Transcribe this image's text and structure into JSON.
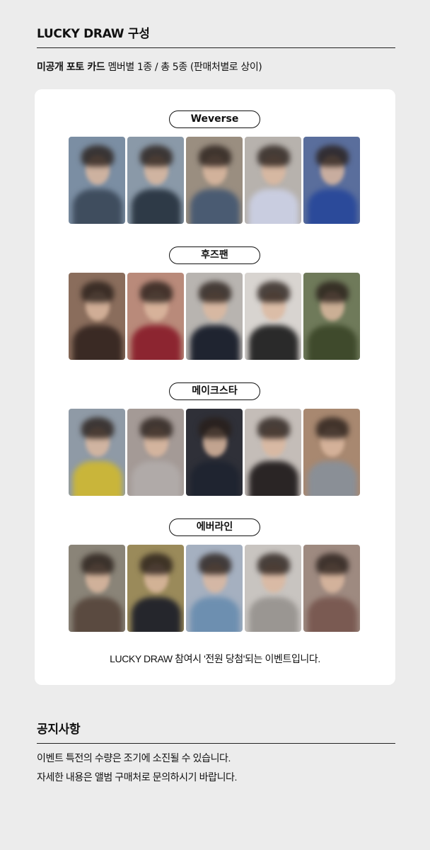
{
  "lucky_draw": {
    "title": "LUCKY DRAW 구성",
    "subtitle_bold": "미공개 포토 카드",
    "subtitle_rest": " 멤버별 1종 / 총 5종 (판매처별로 상이)"
  },
  "stores": [
    {
      "name": "Weverse",
      "photos": [
        {
          "bg": "#7b8ea3",
          "body": "#3f4d5e"
        },
        {
          "bg": "#8a99a8",
          "body": "#2e3a47"
        },
        {
          "bg": "#9a8e80",
          "body": "#4a5b72"
        },
        {
          "bg": "#b7b2ad",
          "body": "#c9cde0"
        },
        {
          "bg": "#5a6e9c",
          "body": "#2b4a9a"
        }
      ]
    },
    {
      "name": "후즈팬",
      "photos": [
        {
          "bg": "#8a6d5c",
          "body": "#3a2a24"
        },
        {
          "bg": "#b98a7a",
          "body": "#8c2530"
        },
        {
          "bg": "#b8b4b0",
          "body": "#1f2430"
        },
        {
          "bg": "#d8d4d0",
          "body": "#2a2a2a"
        },
        {
          "bg": "#6f7a5a",
          "body": "#3f4a2c"
        }
      ]
    },
    {
      "name": "메이크스타",
      "photos": [
        {
          "bg": "#8f9aa6",
          "body": "#c9b53a"
        },
        {
          "bg": "#a49a96",
          "body": "#b0aaa8"
        },
        {
          "bg": "#2f3038",
          "body": "#1f2430"
        },
        {
          "bg": "#c4bdb8",
          "body": "#2a2525"
        },
        {
          "bg": "#a88870",
          "body": "#8a8f96"
        }
      ]
    },
    {
      "name": "에버라인",
      "photos": [
        {
          "bg": "#8a8478",
          "body": "#5a4a40"
        },
        {
          "bg": "#9a8a5a",
          "body": "#25262c"
        },
        {
          "bg": "#a5b0c0",
          "body": "#6d8fb0"
        },
        {
          "bg": "#c8c4c0",
          "body": "#9a9692"
        },
        {
          "bg": "#9e8a80",
          "body": "#7a5a52"
        }
      ]
    }
  ],
  "footnote": "LUCKY DRAW 참여시 '전원 당첨'되는 이벤트입니다.",
  "notice": {
    "title": "공지사항",
    "line1": "이벤트 특전의 수량은 조기에 소진될 수 있습니다.",
    "line2": "자세한 내용은 앨범 구매처로 문의하시기 바랍니다."
  }
}
